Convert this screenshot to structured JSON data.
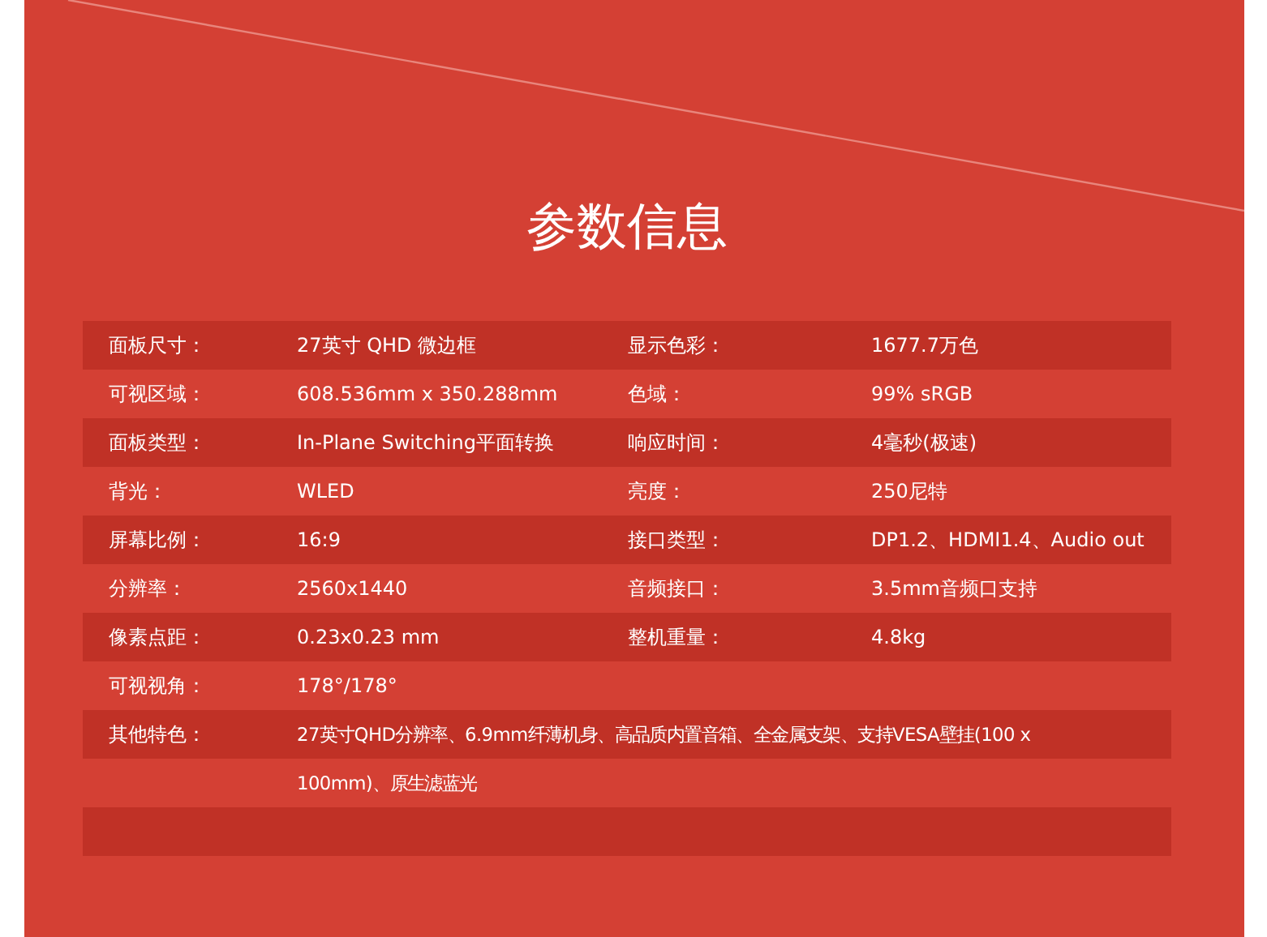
{
  "title": "参数信息",
  "rows": [
    {
      "label": "面板尺寸：",
      "value": "27英寸 QHD 微边框",
      "label_2": "显示色彩：",
      "value_2": "1677.7万色"
    },
    {
      "label": "可视区域：",
      "value": "608.536mm x 350.288mm",
      "label_2": "色域：",
      "value_2": "99% sRGB"
    },
    {
      "label": "面板类型：",
      "value": "In-Plane Switching平面转换",
      "label_2": "响应时间：",
      "value_2": "4毫秒(极速)"
    },
    {
      "label": "背光：",
      "value": "WLED",
      "label_2": "亮度：",
      "value_2": "250尼特"
    },
    {
      "label": "屏幕比例：",
      "value": "16:9",
      "label_2": "接口类型：",
      "value_2": "DP1.2、HDMI1.4、Audio out"
    },
    {
      "label": "分辨率：",
      "value": "2560x1440",
      "label_2": "音频接口：",
      "value_2": "3.5mm音频口支持"
    },
    {
      "label": "像素点距：",
      "value": "0.23x0.23 mm",
      "label_2": "整机重量：",
      "value_2": "4.8kg"
    },
    {
      "label": "可视视角：",
      "value": "178°/178°"
    }
  ],
  "features": {
    "label": "其他特色：",
    "value": "27英寸QHD分辨率、6.9mm纤薄机身、高品质内置音箱、全金属支架、支持VESA壁挂(100 x 100mm)、原生滤蓝光"
  }
}
